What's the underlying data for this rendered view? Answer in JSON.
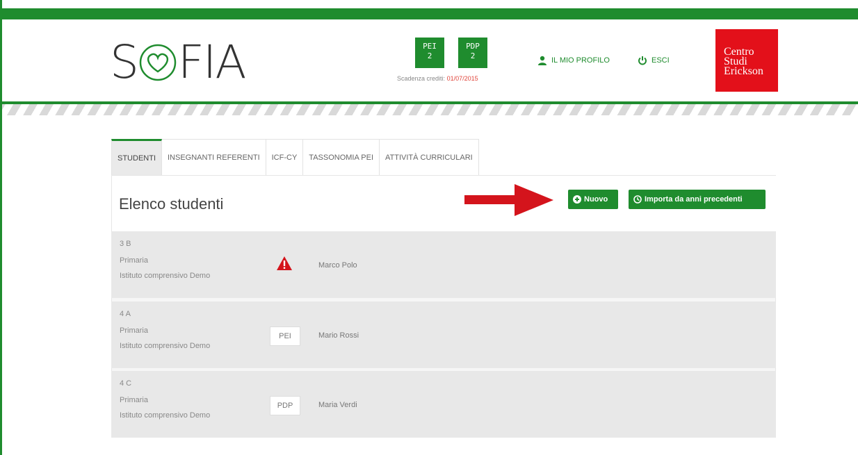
{
  "header": {
    "logo": {
      "left": "S",
      "right": "FIA"
    },
    "credits": [
      {
        "label": "PEI",
        "count": "2"
      },
      {
        "label": "PDP",
        "count": "2"
      }
    ],
    "expiry_label": "Scadenza crediti:",
    "expiry_date": "01/07/2015",
    "profile_label": "IL MIO PROFILO",
    "exit_label": "ESCI",
    "brand": [
      "Centro",
      "Studi",
      "Erickson"
    ]
  },
  "tabs": [
    {
      "label": "STUDENTI",
      "active": true
    },
    {
      "label": "INSEGNANTI REFERENTI"
    },
    {
      "label": "ICF-CY"
    },
    {
      "label": "TASSONOMIA PEI"
    },
    {
      "label": "ATTIVITÀ CURRICULARI"
    }
  ],
  "panel": {
    "title": "Elenco studenti",
    "new_label": "Nuovo",
    "import_label": "Importa da anni precedenti"
  },
  "students": [
    {
      "class": "3 B",
      "level": "Primaria",
      "school": "Istituto comprensivo Demo",
      "badge": "",
      "name": "Marco Polo"
    },
    {
      "class": "4 A",
      "level": "Primaria",
      "school": "Istituto comprensivo Demo",
      "badge": "PEI",
      "name": "Mario Rossi"
    },
    {
      "class": "4 C",
      "level": "Primaria",
      "school": "Istituto comprensivo Demo",
      "badge": "PDP",
      "name": "Maria Verdi"
    }
  ],
  "icons": {
    "heart": "heart-icon",
    "user": "user-icon",
    "power": "power-icon",
    "plus": "plus-circle-icon",
    "import": "clock-circle-icon",
    "warning": "warning-icon",
    "arrow": "arrow-right-icon"
  },
  "colors": {
    "primary": "#1f8c2e",
    "brand": "#e3101a",
    "alert": "#e0443a",
    "arrow": "#d4141c"
  }
}
